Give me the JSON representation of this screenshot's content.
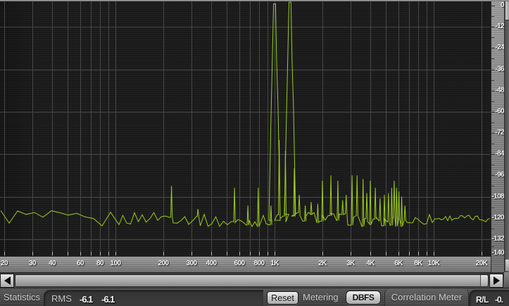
{
  "chart_data": {
    "type": "line",
    "description": "FFT audio spectrum analyzer, two-tone signal with harmonics",
    "trace_color": "#9dcb1f",
    "x_axis": {
      "scale": "log",
      "unit": "Hz",
      "min": 20,
      "max": 20000,
      "grid_freqs": [
        20,
        30,
        40,
        50,
        60,
        70,
        80,
        90,
        100,
        200,
        300,
        400,
        500,
        600,
        700,
        800,
        900,
        1000,
        2000,
        3000,
        4000,
        5000,
        6000,
        7000,
        8000,
        9000,
        10000,
        20000
      ],
      "labels": [
        {
          "f": 20,
          "text": "20"
        },
        {
          "f": 30,
          "text": "30"
        },
        {
          "f": 40,
          "text": "40"
        },
        {
          "f": 60,
          "text": "60"
        },
        {
          "f": 80,
          "text": "80"
        },
        {
          "f": 100,
          "text": "100"
        },
        {
          "f": 200,
          "text": "200"
        },
        {
          "f": 300,
          "text": "300"
        },
        {
          "f": 400,
          "text": "400"
        },
        {
          "f": 600,
          "text": "600"
        },
        {
          "f": 800,
          "text": "800"
        },
        {
          "f": 1000,
          "text": "1K"
        },
        {
          "f": 2000,
          "text": "2K"
        },
        {
          "f": 3000,
          "text": "3K"
        },
        {
          "f": 4000,
          "text": "4K"
        },
        {
          "f": 6000,
          "text": "6K"
        },
        {
          "f": 8000,
          "text": "8K"
        },
        {
          "f": 10000,
          "text": "10K"
        },
        {
          "f": 20000,
          "text": "20K"
        }
      ]
    },
    "y_axis": {
      "unit": "dBFS",
      "min": -140,
      "max": 0,
      "labels": [
        0,
        -12,
        -24,
        -36,
        -48,
        -60,
        -72,
        -84,
        -96,
        -108,
        -120,
        -132,
        -140
      ],
      "minor_tick_db": [
        -6,
        -18,
        -30,
        -42,
        -54,
        -66,
        -78,
        -90,
        -102,
        -114,
        -126,
        -136
      ],
      "grid_db": [
        -12,
        -36,
        -60,
        -84,
        -108,
        -132
      ]
    },
    "main_tones_hz": [
      1000,
      1250
    ],
    "noise_floor": {
      "base_db": -121,
      "lf_jitter_db": 5.0,
      "mid_jitter_db": 3.2,
      "hf_jitter_db": 1.6,
      "slow_wave_db": 1.5
    },
    "spikes": [
      [
        225,
        -102
      ],
      [
        330,
        -115
      ],
      [
        560,
        -103
      ],
      [
        680,
        -113
      ],
      [
        790,
        -103
      ],
      [
        950,
        -113
      ],
      [
        1000,
        1
      ],
      [
        1070,
        -76
      ],
      [
        1170,
        -82
      ],
      [
        1250,
        2
      ],
      [
        1330,
        -92
      ],
      [
        1430,
        -107
      ],
      [
        1560,
        -113
      ],
      [
        1700,
        -111
      ],
      [
        1870,
        -112
      ],
      [
        2000,
        -99
      ],
      [
        2260,
        -96
      ],
      [
        2500,
        -99
      ],
      [
        2680,
        -110
      ],
      [
        2820,
        -107
      ],
      [
        3070,
        -96
      ],
      [
        3300,
        -96
      ],
      [
        3600,
        -98
      ],
      [
        3800,
        -106
      ],
      [
        4000,
        -99
      ],
      [
        4300,
        -103
      ],
      [
        4600,
        -109
      ],
      [
        4900,
        -107
      ],
      [
        5200,
        -106
      ],
      [
        5450,
        -103
      ],
      [
        5650,
        -99
      ],
      [
        5850,
        -103
      ],
      [
        6050,
        -105
      ],
      [
        6300,
        -108
      ],
      [
        6600,
        -113
      ]
    ]
  },
  "statusbar": {
    "statistics_tab": "Statistics",
    "rms_label": "RMS",
    "rms_values": [
      "-6.1",
      "-6.1"
    ],
    "reset_button": "Reset",
    "metering_label": "Metering",
    "dbfs_button": "DBFS",
    "correlation_tab": "Correlation Meter",
    "rl_label": "R/L",
    "rl_value": "-0."
  },
  "colors": {
    "trace": "#9dcb1f",
    "grid": "#474747",
    "plot_bg": "#1a1a1a",
    "label_text": "#f0f0f0"
  }
}
